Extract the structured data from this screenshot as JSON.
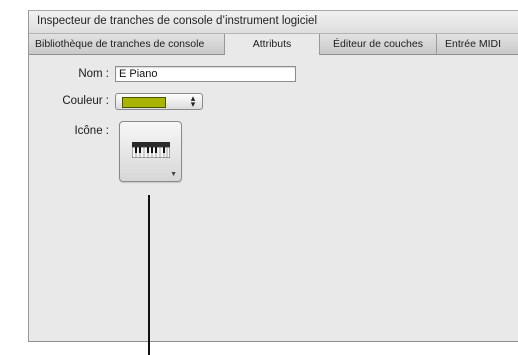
{
  "window": {
    "title": "Inspecteur de tranches de console d’instrument logiciel"
  },
  "tabs": [
    {
      "label": "Bibliothèque de tranches de console",
      "active": false
    },
    {
      "label": "Attributs",
      "active": true
    },
    {
      "label": "Éditeur de couches",
      "active": false
    },
    {
      "label": "Entrée MIDI",
      "active": false
    }
  ],
  "attributes": {
    "name_label": "Nom :",
    "name_value": "E Piano",
    "color_label": "Couleur :",
    "color_value": "#a8b400",
    "color_popup_icon": "up-down-arrows-icon",
    "icon_label": "Icône :",
    "icon_image": "keyboard-icon",
    "icon_menu_indicator": "triangle-down-icon"
  }
}
